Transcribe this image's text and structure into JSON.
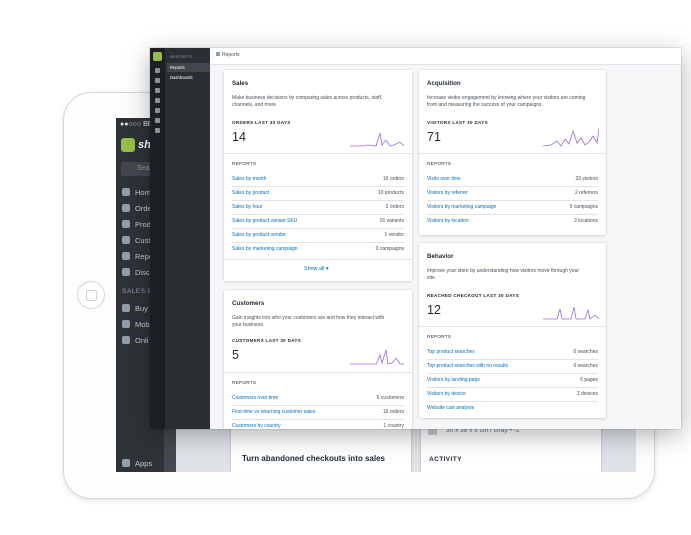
{
  "ipad": {
    "status_text": "●●○○○ BELL",
    "logo_text": "shop",
    "search_placeholder": "Sea",
    "nav_items": [
      "Hom",
      "Orde",
      "Prod",
      "Cust",
      "Repo",
      "Disc"
    ],
    "section_label": "SALES CH",
    "channel_items": [
      "Buy",
      "Mob",
      "Onli"
    ],
    "apps_label": "Apps",
    "abandoned_title": "Turn abandoned checkouts into sales",
    "product_dims": "30 x 38 x 5 cm / Gray • -1",
    "activity_label": "ACTIVITY"
  },
  "window": {
    "nav_heading": "REPORTS",
    "nav_items": [
      "Reports",
      "Dashboards"
    ],
    "breadcrumb": "Reports",
    "sales": {
      "title": "Sales",
      "description_lines": [
        "Make business decisions by comparing sales across products, staff,",
        "channels, and more."
      ],
      "metric_label": "ORDERS LAST 30 DAYS",
      "metric_value": "14",
      "reports_label": "REPORTS",
      "rows": [
        {
          "label": "Sales by month",
          "value": "16 orders"
        },
        {
          "label": "Sales by product",
          "value": "10 products"
        },
        {
          "label": "Sales by hour",
          "value": "2 orders"
        },
        {
          "label": "Sales by product variant SKU",
          "value": "16 variants"
        },
        {
          "label": "Sales by product vendor",
          "value": "1 vendor"
        },
        {
          "label": "Sales by marketing campaign",
          "value": "0 campaigns"
        }
      ],
      "show_all": "Show all ▾"
    },
    "customers": {
      "title": "Customers",
      "description_lines": [
        "Gain insights into who your customers are and how they interact with",
        "your business."
      ],
      "metric_label": "CUSTOMERS LAST 30 DAYS",
      "metric_value": "5",
      "reports_label": "REPORTS",
      "rows": [
        {
          "label": "Customers over time",
          "value": "6 customers"
        },
        {
          "label": "First-time vs returning customer sales",
          "value": "16 orders"
        },
        {
          "label": "Customers by country",
          "value": "1 country"
        }
      ]
    },
    "acquisition": {
      "title": "Acquisition",
      "description_lines": [
        "Increase visitor engagement by knowing where your visitors are coming",
        "from and measuring the success of your campaigns."
      ],
      "metric_label": "VISITORS LAST 30 DAYS",
      "metric_value": "71",
      "reports_label": "REPORTS",
      "rows": [
        {
          "label": "Visits over time",
          "value": "33 visitors"
        },
        {
          "label": "Visitors by referrer",
          "value": "2 referrers"
        },
        {
          "label": "Visitors by marketing campaign",
          "value": "0 campaigns"
        },
        {
          "label": "Visitors by location",
          "value": "2 locations"
        }
      ]
    },
    "behavior": {
      "title": "Behavior",
      "description_lines": [
        "Improve your store by understanding how visitors move through your",
        "site."
      ],
      "metric_label": "REACHED CHECKOUT LAST 30 DAYS",
      "metric_value": "12",
      "reports_label": "REPORTS",
      "rows": [
        {
          "label": "Top product searches",
          "value": "0 searches"
        },
        {
          "label": "Top product searches with no results",
          "value": "0 searches"
        },
        {
          "label": "Visitors by landing page",
          "value": "6 pages"
        },
        {
          "label": "Visitors by device",
          "value": "2 devices"
        }
      ],
      "extra_link": "Website cart analysis"
    },
    "colors": {
      "spark": "#9c6ade",
      "link": "#006fbb",
      "brand": "#96bf48"
    }
  }
}
